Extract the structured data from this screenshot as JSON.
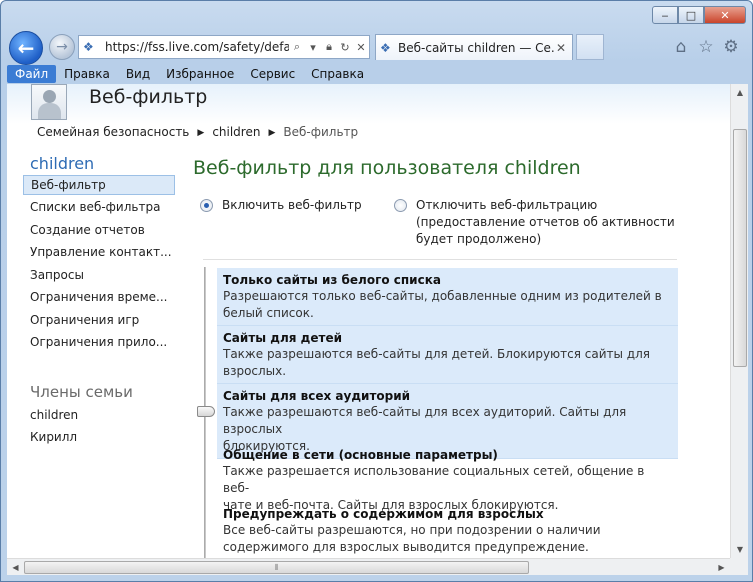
{
  "browser": {
    "address_url": "https://fss.live.com/safety/default",
    "tab_title": "Веб-сайты children — Се...",
    "caption_min": "‒",
    "caption_max": "□",
    "caption_close": "✕"
  },
  "menu": [
    "Файл",
    "Правка",
    "Вид",
    "Избранное",
    "Сервис",
    "Справка"
  ],
  "page": {
    "title": "Веб-фильтр",
    "breadcrumb": [
      "Семейная безопасность",
      "children",
      "Веб-фильтр"
    ]
  },
  "sidebar": {
    "user": "children",
    "items": [
      "Веб-фильтр",
      "Списки веб-фильтра",
      "Создание отчетов",
      "Управление контакт...",
      "Запросы",
      "Ограничения време...",
      "Ограничения игр",
      "Ограничения прило..."
    ],
    "members_heading": "Члены семьи",
    "members": [
      "children",
      "Кирилл"
    ]
  },
  "main": {
    "heading": "Веб-фильтр для пользователя children",
    "radio_on_label": "Включить веб-фильтр",
    "radio_off_line1": "Отключить веб-фильтрацию",
    "radio_off_line2": "(предоставление отчетов об активности",
    "radio_off_line3": "будет продолжено)",
    "selected_level": 3,
    "levels": [
      {
        "title": "Только сайты из белого списка",
        "desc1": "Разрешаются только веб-сайты, добавленные одним из родителей в",
        "desc2": "белый список."
      },
      {
        "title": "Сайты для детей",
        "desc1": "Также разрешаются веб-сайты для детей. Блокируются сайты для",
        "desc2": "взрослых."
      },
      {
        "title": "Сайты для всех аудиторий",
        "desc1": "Также разрешаются веб-сайты для всех аудиторий. Сайты для взрослых",
        "desc2": "блокируются."
      },
      {
        "title": "Общение в сети (основные параметры)",
        "desc1": "Также разрешается использование социальных сетей, общение в веб-",
        "desc2": "чате и веб-почта. Сайты для взрослых блокируются."
      },
      {
        "title": "Предупреждать о содержимом для взрослых",
        "desc1": "Все веб-сайты разрешаются, но при подозрении о наличии",
        "desc2": "содержимого для взрослых выводится предупреждение."
      }
    ]
  }
}
